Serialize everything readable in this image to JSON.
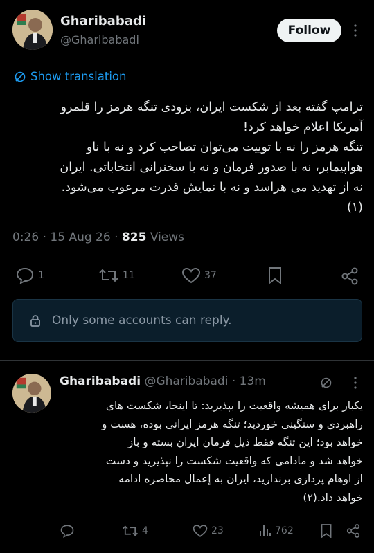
{
  "main_tweet": {
    "author_name": "Gharibabadi",
    "author_handle": "@Gharibabadi",
    "follow_label": "Follow",
    "translate_label": "Show translation",
    "text": "ترامپ گفته بعد از شکست ایران، بزودی تنگه هرمز را قلمرو\nآمریکا اعلام خواهد کرد!\nتنگه هرمز را نه با توییت می‌توان تصاحب کرد و نه با ناو\nهواپیمابر، نه با صدور فرمان و نه با سخنرانی انتخاباتی. ایران\nنه از تهدید می هراسد و نه با نمایش قدرت مرعوب می‌شود.\n(۱)",
    "time": "0:26",
    "date": "15 Aug 26",
    "views_count": "825",
    "views_label": "Views",
    "stats": {
      "replies": "1",
      "reposts": "11",
      "likes": "37"
    },
    "reply_restriction": "Only some accounts can reply."
  },
  "reply_tweet": {
    "author_name": "Gharibabadi",
    "author_handle": "@Gharibabadi",
    "time_ago": "13m",
    "text": "یکبار برای همیشه واقعیت را بپذیرید: تا اینجا، شکست های\nراهبردی و سنگینی خوردید؛ تنگه هرمز ایرانی بوده، هست و\nخواهد بود؛ این تنگه فقط ذیل فرمان ایران بسته و باز\nخواهد شد و مادامی که واقعیت شکست را نپذیرید و دست\nاز اوهام پردازی برندارید، ایران به إعمال محاصره ادامه\nخواهد داد.(۲)",
    "stats": {
      "reposts": "4",
      "likes": "23",
      "views": "762"
    }
  },
  "colors": {
    "background": "#000000",
    "text": "#e7e9ea",
    "muted": "#71767b",
    "link": "#1d9bf0",
    "follow_bg": "#eff3f4"
  }
}
